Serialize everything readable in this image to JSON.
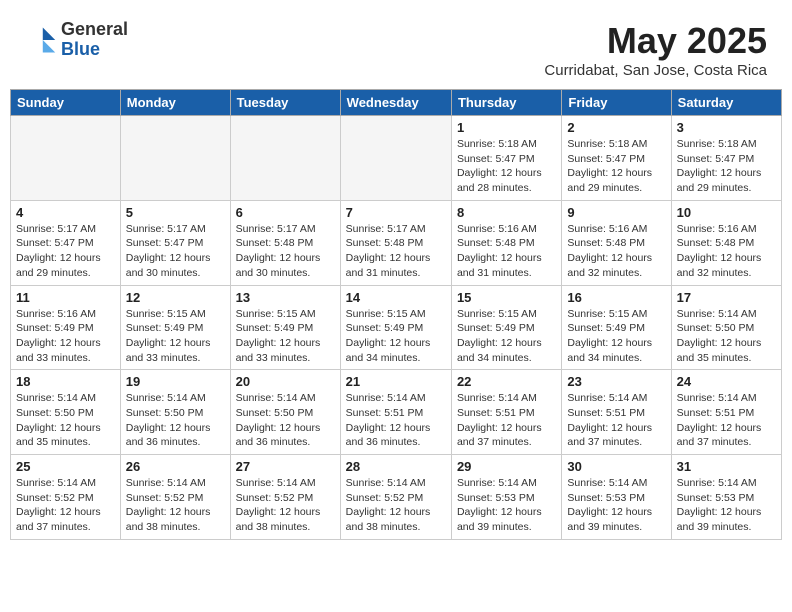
{
  "header": {
    "logo_general": "General",
    "logo_blue": "Blue",
    "month_title": "May 2025",
    "subtitle": "Curridabat, San Jose, Costa Rica"
  },
  "calendar": {
    "days_of_week": [
      "Sunday",
      "Monday",
      "Tuesday",
      "Wednesday",
      "Thursday",
      "Friday",
      "Saturday"
    ],
    "weeks": [
      [
        {
          "day": "",
          "info": ""
        },
        {
          "day": "",
          "info": ""
        },
        {
          "day": "",
          "info": ""
        },
        {
          "day": "",
          "info": ""
        },
        {
          "day": "1",
          "info": "Sunrise: 5:18 AM\nSunset: 5:47 PM\nDaylight: 12 hours\nand 28 minutes."
        },
        {
          "day": "2",
          "info": "Sunrise: 5:18 AM\nSunset: 5:47 PM\nDaylight: 12 hours\nand 29 minutes."
        },
        {
          "day": "3",
          "info": "Sunrise: 5:18 AM\nSunset: 5:47 PM\nDaylight: 12 hours\nand 29 minutes."
        }
      ],
      [
        {
          "day": "4",
          "info": "Sunrise: 5:17 AM\nSunset: 5:47 PM\nDaylight: 12 hours\nand 29 minutes."
        },
        {
          "day": "5",
          "info": "Sunrise: 5:17 AM\nSunset: 5:47 PM\nDaylight: 12 hours\nand 30 minutes."
        },
        {
          "day": "6",
          "info": "Sunrise: 5:17 AM\nSunset: 5:48 PM\nDaylight: 12 hours\nand 30 minutes."
        },
        {
          "day": "7",
          "info": "Sunrise: 5:17 AM\nSunset: 5:48 PM\nDaylight: 12 hours\nand 31 minutes."
        },
        {
          "day": "8",
          "info": "Sunrise: 5:16 AM\nSunset: 5:48 PM\nDaylight: 12 hours\nand 31 minutes."
        },
        {
          "day": "9",
          "info": "Sunrise: 5:16 AM\nSunset: 5:48 PM\nDaylight: 12 hours\nand 32 minutes."
        },
        {
          "day": "10",
          "info": "Sunrise: 5:16 AM\nSunset: 5:48 PM\nDaylight: 12 hours\nand 32 minutes."
        }
      ],
      [
        {
          "day": "11",
          "info": "Sunrise: 5:16 AM\nSunset: 5:49 PM\nDaylight: 12 hours\nand 33 minutes."
        },
        {
          "day": "12",
          "info": "Sunrise: 5:15 AM\nSunset: 5:49 PM\nDaylight: 12 hours\nand 33 minutes."
        },
        {
          "day": "13",
          "info": "Sunrise: 5:15 AM\nSunset: 5:49 PM\nDaylight: 12 hours\nand 33 minutes."
        },
        {
          "day": "14",
          "info": "Sunrise: 5:15 AM\nSunset: 5:49 PM\nDaylight: 12 hours\nand 34 minutes."
        },
        {
          "day": "15",
          "info": "Sunrise: 5:15 AM\nSunset: 5:49 PM\nDaylight: 12 hours\nand 34 minutes."
        },
        {
          "day": "16",
          "info": "Sunrise: 5:15 AM\nSunset: 5:49 PM\nDaylight: 12 hours\nand 34 minutes."
        },
        {
          "day": "17",
          "info": "Sunrise: 5:14 AM\nSunset: 5:50 PM\nDaylight: 12 hours\nand 35 minutes."
        }
      ],
      [
        {
          "day": "18",
          "info": "Sunrise: 5:14 AM\nSunset: 5:50 PM\nDaylight: 12 hours\nand 35 minutes."
        },
        {
          "day": "19",
          "info": "Sunrise: 5:14 AM\nSunset: 5:50 PM\nDaylight: 12 hours\nand 36 minutes."
        },
        {
          "day": "20",
          "info": "Sunrise: 5:14 AM\nSunset: 5:50 PM\nDaylight: 12 hours\nand 36 minutes."
        },
        {
          "day": "21",
          "info": "Sunrise: 5:14 AM\nSunset: 5:51 PM\nDaylight: 12 hours\nand 36 minutes."
        },
        {
          "day": "22",
          "info": "Sunrise: 5:14 AM\nSunset: 5:51 PM\nDaylight: 12 hours\nand 37 minutes."
        },
        {
          "day": "23",
          "info": "Sunrise: 5:14 AM\nSunset: 5:51 PM\nDaylight: 12 hours\nand 37 minutes."
        },
        {
          "day": "24",
          "info": "Sunrise: 5:14 AM\nSunset: 5:51 PM\nDaylight: 12 hours\nand 37 minutes."
        }
      ],
      [
        {
          "day": "25",
          "info": "Sunrise: 5:14 AM\nSunset: 5:52 PM\nDaylight: 12 hours\nand 37 minutes."
        },
        {
          "day": "26",
          "info": "Sunrise: 5:14 AM\nSunset: 5:52 PM\nDaylight: 12 hours\nand 38 minutes."
        },
        {
          "day": "27",
          "info": "Sunrise: 5:14 AM\nSunset: 5:52 PM\nDaylight: 12 hours\nand 38 minutes."
        },
        {
          "day": "28",
          "info": "Sunrise: 5:14 AM\nSunset: 5:52 PM\nDaylight: 12 hours\nand 38 minutes."
        },
        {
          "day": "29",
          "info": "Sunrise: 5:14 AM\nSunset: 5:53 PM\nDaylight: 12 hours\nand 39 minutes."
        },
        {
          "day": "30",
          "info": "Sunrise: 5:14 AM\nSunset: 5:53 PM\nDaylight: 12 hours\nand 39 minutes."
        },
        {
          "day": "31",
          "info": "Sunrise: 5:14 AM\nSunset: 5:53 PM\nDaylight: 12 hours\nand 39 minutes."
        }
      ]
    ]
  }
}
